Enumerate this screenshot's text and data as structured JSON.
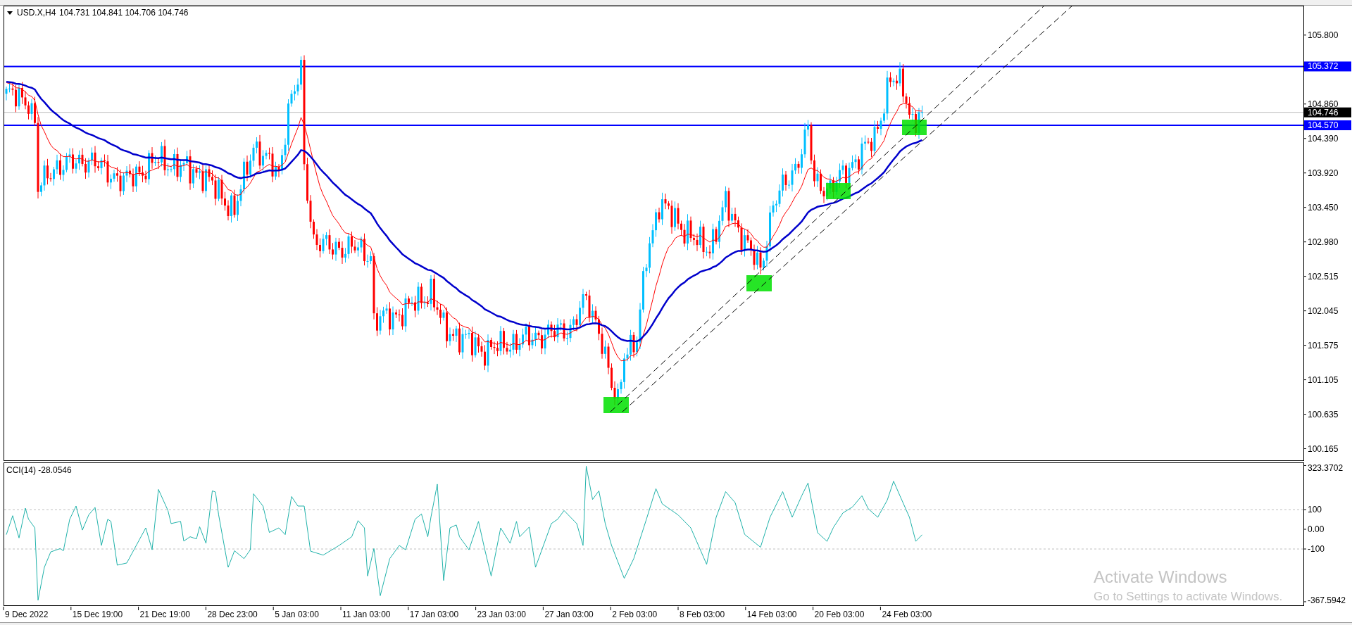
{
  "main_chart": {
    "symbol": "USD.X,H4",
    "quote": "104.731 104.841 104.706 104.746",
    "price_axis": [
      "105.800",
      "104.860",
      "104.390",
      "103.920",
      "103.450",
      "102.980",
      "102.515",
      "102.045",
      "101.575",
      "101.105",
      "100.635",
      "100.165"
    ],
    "price_tags": [
      {
        "label": "105.372",
        "kind": "level"
      },
      {
        "label": "104.746",
        "kind": "bid"
      },
      {
        "label": "104.570",
        "kind": "level"
      }
    ]
  },
  "indicator": {
    "label": "CCI(14) -28.0546",
    "axis": [
      "323.3702",
      "100",
      "0.00",
      "-100",
      "-367.5942"
    ]
  },
  "time_axis": [
    "9 Dec 2022",
    "15 Dec 19:00",
    "21 Dec 19:00",
    "28 Dec 23:00",
    "5 Jan 03:00",
    "11 Jan 03:00",
    "17 Jan 03:00",
    "23 Jan 03:00",
    "27 Jan 03:00",
    "2 Feb 03:00",
    "8 Feb 03:00",
    "14 Feb 03:00",
    "20 Feb 03:00",
    "24 Feb 03:00"
  ],
  "overlay": {
    "title": "Activate Windows",
    "subtitle": "Go to Settings to activate Windows."
  }
}
